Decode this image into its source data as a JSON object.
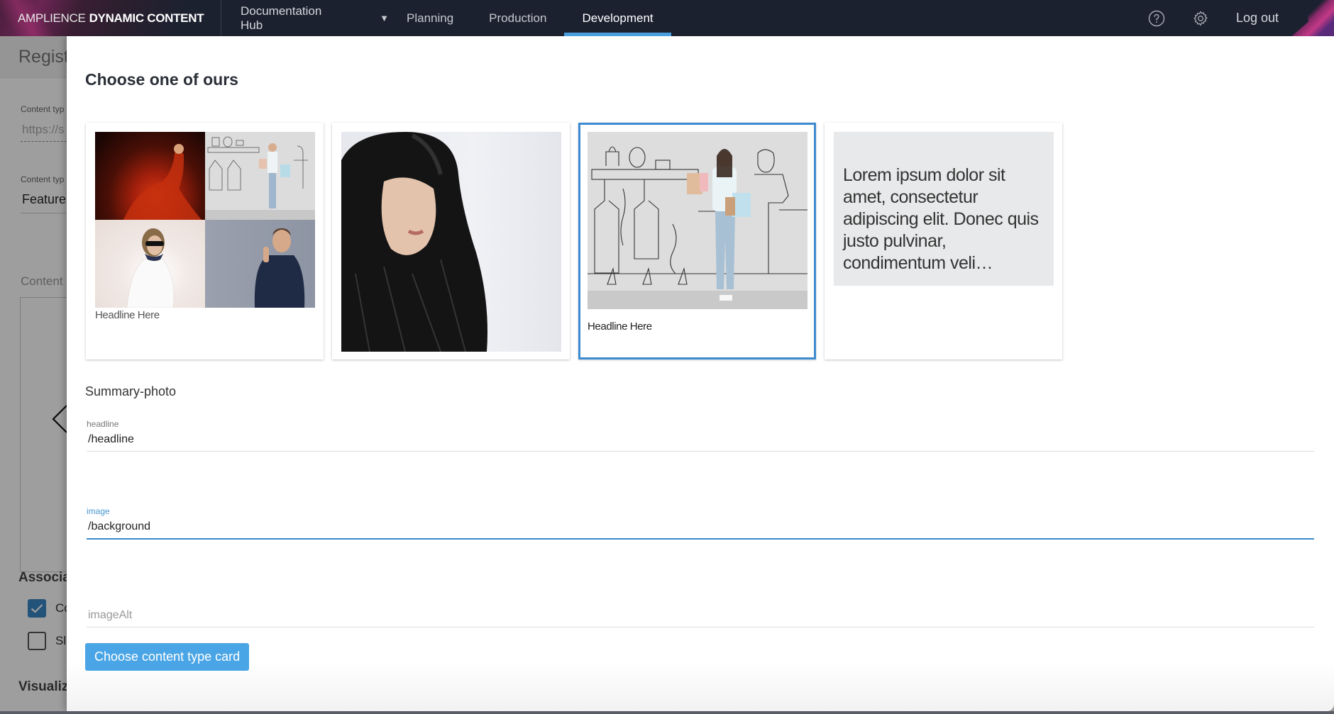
{
  "app": {
    "brand_light": "AMPLIENCE",
    "brand_bold": "DYNAMIC CONTENT"
  },
  "nav": {
    "hub_label": "Documentation Hub",
    "tabs": [
      {
        "label": "Planning",
        "active": false
      },
      {
        "label": "Production",
        "active": false
      },
      {
        "label": "Development",
        "active": true
      }
    ],
    "help_icon": "help-circle-icon",
    "settings_icon": "gear-icon",
    "logout_label": "Log out"
  },
  "background_page": {
    "title": "Registe",
    "content_type_url_label": "Content typ",
    "content_type_url_placeholder": "https://s",
    "content_type_label_label": "Content typ",
    "content_type_label_value": "Feature ",
    "content_section_label": "Content ",
    "associated_title": "Associat",
    "checkboxes": [
      {
        "label": "Co",
        "checked": true
      },
      {
        "label": "Sl",
        "checked": false
      }
    ],
    "visualization_title": "Visualiza"
  },
  "modal": {
    "title": "Choose one of ours",
    "cards": [
      {
        "kind": "four-photo-grid",
        "headline": "Headline Here",
        "selected": false
      },
      {
        "kind": "single-photo",
        "headline": "",
        "selected": false
      },
      {
        "kind": "photo-with-headline",
        "headline": "Headline Here",
        "selected": true
      },
      {
        "kind": "text",
        "text": "Lorem ipsum dolor sit amet, consectetur adipiscing elit. Donec quis justo pulvinar, condimentum veli…",
        "selected": false
      }
    ],
    "section_title": "Summary-photo",
    "fields": [
      {
        "label": "headline",
        "value": "/headline",
        "placeholder": "",
        "focused": false
      },
      {
        "label": "image",
        "value": "/background",
        "placeholder": "",
        "focused": true
      },
      {
        "label": "",
        "value": "",
        "placeholder": "imageAlt",
        "focused": false
      }
    ],
    "primary_button": "Choose content type card"
  },
  "colors": {
    "nav_bg": "#1c2130",
    "accent_blue": "#4a9fe0",
    "selected_card_border": "#3d8bd0",
    "primary_button": "#4aa5e6",
    "focused_label": "#4a96cf"
  }
}
